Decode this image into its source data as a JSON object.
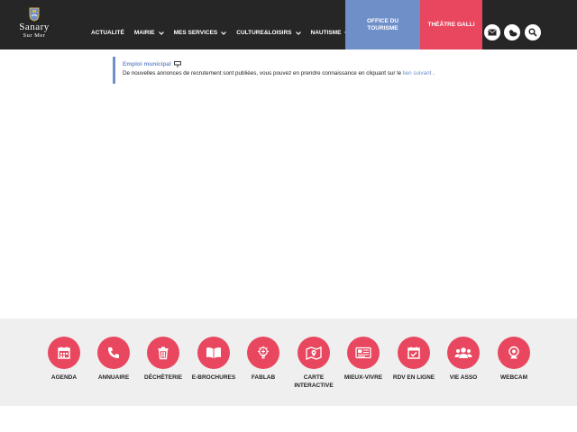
{
  "header": {
    "logo": {
      "line1": "Sanary",
      "line2": "Sur Mer"
    },
    "nav": [
      {
        "label": "Actualité",
        "has_chevron": false
      },
      {
        "label": "Mairie",
        "has_chevron": true
      },
      {
        "label": "Mes services",
        "has_chevron": true
      },
      {
        "label": "Culture&Loisirs",
        "has_chevron": true
      },
      {
        "label": "Nautisme",
        "has_chevron": true
      }
    ],
    "office_label": "OFFICE DU TOURISME",
    "galli_label": "THÉÂTRE GALLI",
    "icons": [
      "mail-icon",
      "weather-icon",
      "search-icon"
    ]
  },
  "notice": {
    "title": "Emploi municipal",
    "text_before": "De nouvelles annonces de recrutement sont publiées, vous pouvez en prendre connaissance en cliquant sur le ",
    "link_text": "lien suivant",
    "text_after": " ."
  },
  "services": [
    {
      "label": "Agenda",
      "icon": "calendar-icon"
    },
    {
      "label": "Annuaire",
      "icon": "phone-icon"
    },
    {
      "label": "Déchèterie",
      "icon": "trash-icon"
    },
    {
      "label": "E-Brochures",
      "icon": "book-icon"
    },
    {
      "label": "Fablab",
      "icon": "lightbulb-icon"
    },
    {
      "label": "Carte interactive",
      "icon": "map-icon"
    },
    {
      "label": "Mieux-vivre",
      "icon": "newspaper-icon"
    },
    {
      "label": "RDV en ligne",
      "icon": "calendar-check-icon"
    },
    {
      "label": "Vie asso",
      "icon": "users-icon"
    },
    {
      "label": "Webcam",
      "icon": "webcam-icon"
    }
  ],
  "colors": {
    "header_bg": "#262626",
    "accent_blue": "#6f8fc9",
    "accent_pink": "#e8475f",
    "footer_bg": "#efefef"
  }
}
